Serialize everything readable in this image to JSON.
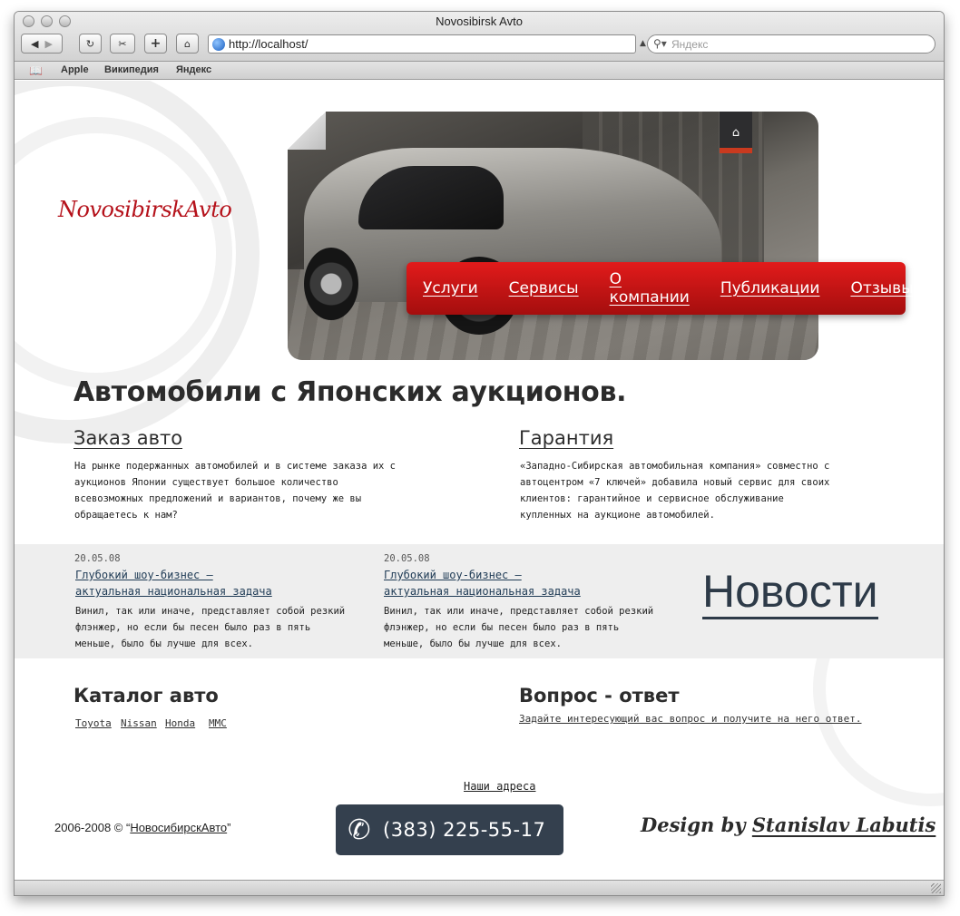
{
  "window": {
    "title": "Novosibirsk Avto",
    "url": "http://localhost/",
    "search_placeholder": "Яндекс",
    "bookmarks": [
      "Apple",
      "Википедия",
      "Яндекс"
    ]
  },
  "site": {
    "logo": "NovosibirskAvto",
    "menu": [
      "Услуги",
      "Сервисы",
      "О компании",
      "Публикации",
      "Отзывы"
    ],
    "headline": "Автомобили с Японских аукционов.",
    "order": {
      "title": "Заказ авто",
      "lines": [
        "На рынке подержанных автомобилей и в системе заказа их с",
        "аукционов Японии существует большое количество",
        "всевозможных предложений и вариантов, почему же вы",
        "обращаетесь к нам?"
      ]
    },
    "warranty": {
      "title": "Гарантия",
      "lines": [
        "«Западно-Сибирская автомобильная компания» совместно с",
        "автоцентром «7 ключей» добавила новый сервис для своих",
        "клиентов: гарантийное и сервисное обслуживание",
        "купленных на аукционе автомобилей."
      ]
    },
    "news": {
      "heading": "Новости",
      "items": [
        {
          "date": "20.05.08",
          "title_lines": [
            "Глубокий шоу-бизнес —",
            "актуальная национальная задача"
          ],
          "text_lines": [
            "Винил, так или иначе, представляет собой резкий",
            "флэнжер, но если бы песен было раз в пять",
            "меньше, было бы лучше для всех."
          ]
        },
        {
          "date": "20.05.08",
          "title_lines": [
            "Глубокий шоу-бизнес —",
            "актуальная национальная задача"
          ],
          "text_lines": [
            "Винил, так или иначе, представляет собой резкий",
            "флэнжер, но если бы песен было раз в пять",
            "меньше, было бы лучше для всех."
          ]
        }
      ]
    },
    "catalog": {
      "title": "Каталог авто",
      "brands": [
        "Toyota",
        "Nissan",
        "Honda",
        "MMC"
      ]
    },
    "qa": {
      "title": "Вопрос - ответ",
      "link": "Задайте интересующий вас вопрос и получите на него ответ."
    },
    "footer": {
      "addresses": "Наши адреса",
      "copyright_prefix": "2006-2008 © “",
      "copyright_link": "НовосибирскАвто",
      "copyright_suffix": "”",
      "phone": "(383) 225-55-17",
      "design_prefix": "Design by",
      "design_author": "Stanislav Labutis"
    }
  },
  "colors": {
    "menu_red": "#c81414",
    "logo_red": "#b5121b",
    "phone_bg": "#34404e",
    "news_heading": "#2d3a48",
    "news_band": "#eeeeee"
  }
}
